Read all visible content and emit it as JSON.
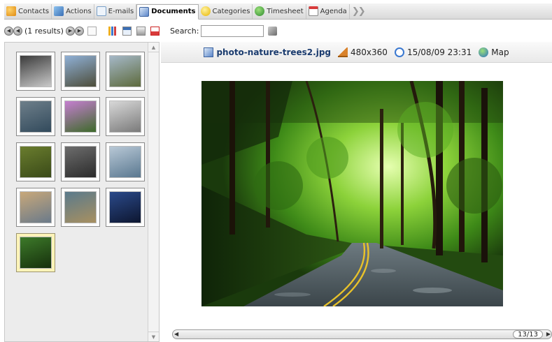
{
  "tabs": [
    {
      "label": "Contacts",
      "icon": "contacts-icon",
      "color": "#f0a020"
    },
    {
      "label": "Actions",
      "icon": "actions-icon",
      "color": "#5a8fd0"
    },
    {
      "label": "E-mails",
      "icon": "emails-icon",
      "color": "#7aa0c8"
    },
    {
      "label": "Documents",
      "icon": "documents-icon",
      "color": "#5b86c9"
    },
    {
      "label": "Categories",
      "icon": "categories-icon",
      "color": "#f3c323"
    },
    {
      "label": "Timesheet",
      "icon": "timesheet-icon",
      "color": "#3b9a3b"
    },
    {
      "label": "Agenda",
      "icon": "agenda-icon",
      "color": "#d93b3b"
    }
  ],
  "toolbar": {
    "results": "(1 results)",
    "search_label": "Search:",
    "search_value": ""
  },
  "viewer": {
    "file_name": "photo-nature-trees2.jpg",
    "dimensions": "480x360",
    "date": "15/08/09 23:31",
    "map_label": "Map",
    "page_counter": "13/13"
  },
  "thumbnails": [
    {
      "name": "thumb-1",
      "colors": [
        "#3b3b3b",
        "#c9c9c9"
      ]
    },
    {
      "name": "thumb-2",
      "colors": [
        "#8fb0d6",
        "#4d4d3a"
      ]
    },
    {
      "name": "thumb-3",
      "colors": [
        "#a5b8c8",
        "#5d6a3c"
      ]
    },
    {
      "name": "thumb-4",
      "colors": [
        "#6e7f8a",
        "#324a5c"
      ]
    },
    {
      "name": "thumb-5",
      "colors": [
        "#c67fd1",
        "#3d6a2a"
      ]
    },
    {
      "name": "thumb-6",
      "colors": [
        "#d8d8d8",
        "#7a7a7a"
      ]
    },
    {
      "name": "thumb-7",
      "colors": [
        "#6a7d2e",
        "#3a4a18"
      ]
    },
    {
      "name": "thumb-8",
      "colors": [
        "#6d6d6d",
        "#2b2b2b"
      ]
    },
    {
      "name": "thumb-9",
      "colors": [
        "#b8c8d6",
        "#5a7890"
      ]
    },
    {
      "name": "thumb-10",
      "colors": [
        "#c8a87a",
        "#6a7a8a"
      ]
    },
    {
      "name": "thumb-11",
      "colors": [
        "#5a7a8c",
        "#a89060"
      ]
    },
    {
      "name": "thumb-12",
      "colors": [
        "#2b4a8a",
        "#0d1630"
      ]
    },
    {
      "name": "thumb-13",
      "colors": [
        "#3d7a2a",
        "#16300c"
      ],
      "selected": true
    }
  ]
}
